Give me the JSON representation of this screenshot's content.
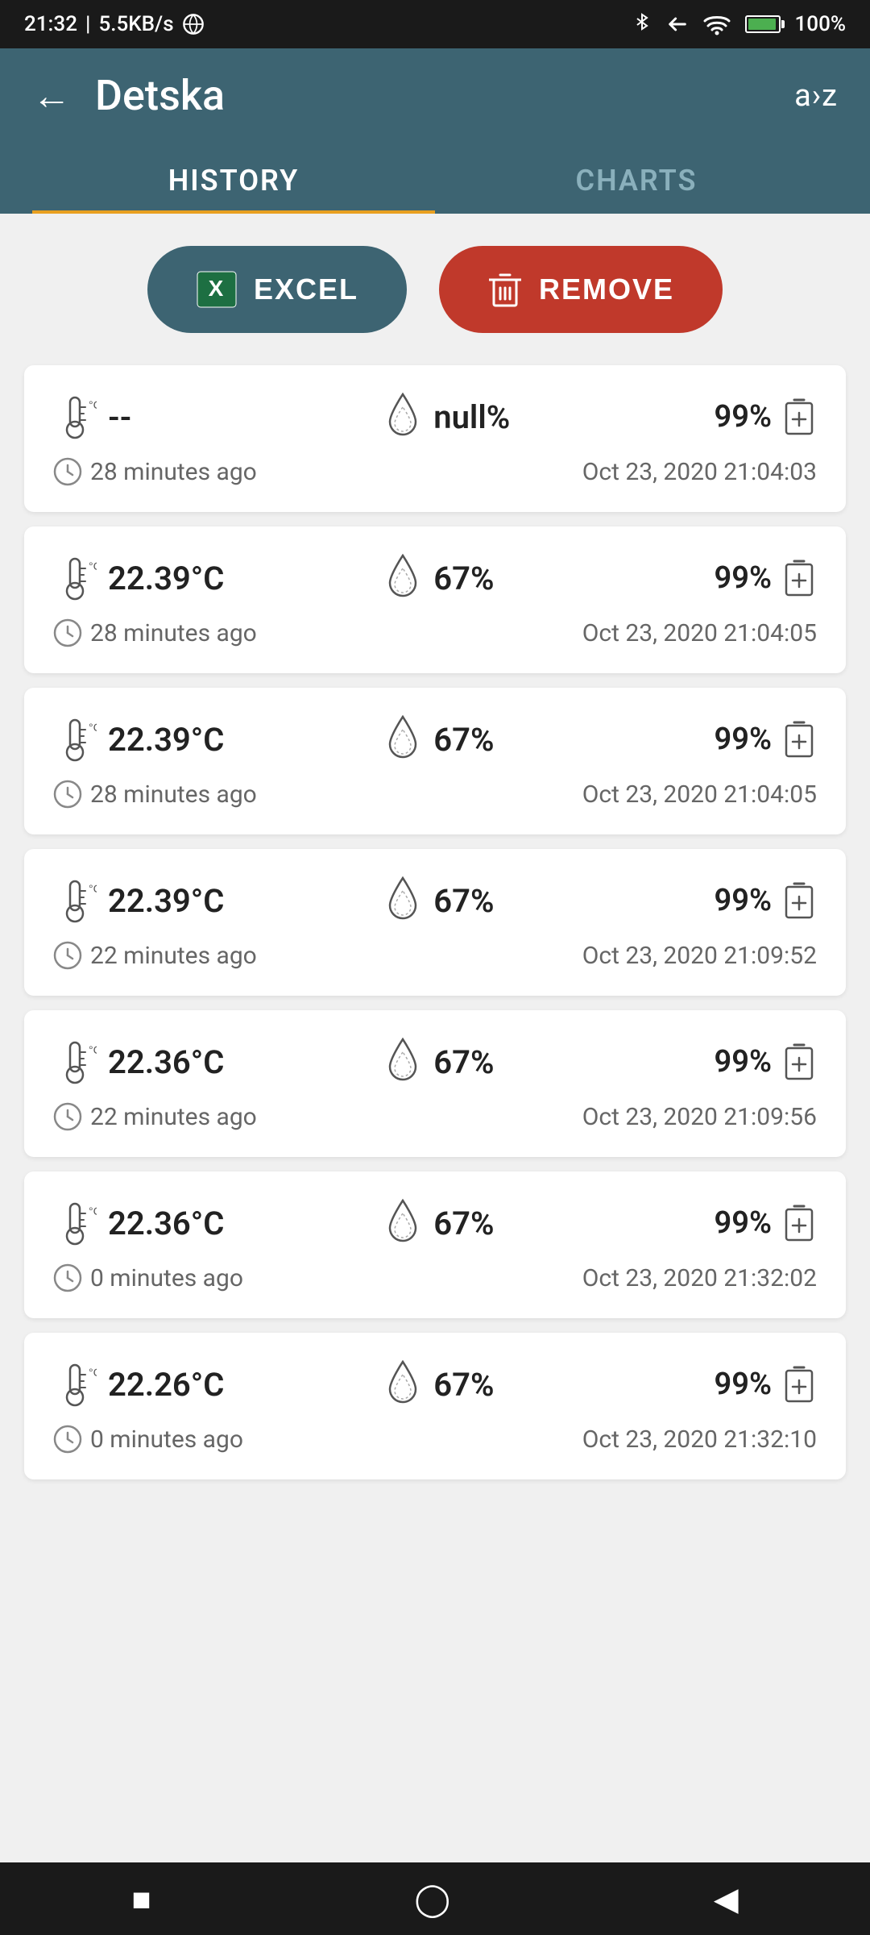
{
  "statusBar": {
    "time": "21:32",
    "network": "5.5KB/s",
    "battery_pct": "100%"
  },
  "header": {
    "title": "Detska",
    "back_label": "←",
    "sort_label": "a›z"
  },
  "tabs": [
    {
      "id": "history",
      "label": "HISTORY",
      "active": true
    },
    {
      "id": "charts",
      "label": "CHARTS",
      "active": false
    }
  ],
  "buttons": {
    "excel_label": "EXCEL",
    "remove_label": "REMOVE"
  },
  "records": [
    {
      "temp": "--",
      "humidity": "null%",
      "battery": "99%",
      "time_ago": "28 minutes ago",
      "date": "Oct 23, 2020 21:04:03"
    },
    {
      "temp": "22.39°C",
      "humidity": "67%",
      "battery": "99%",
      "time_ago": "28 minutes ago",
      "date": "Oct 23, 2020 21:04:05"
    },
    {
      "temp": "22.39°C",
      "humidity": "67%",
      "battery": "99%",
      "time_ago": "28 minutes ago",
      "date": "Oct 23, 2020 21:04:05"
    },
    {
      "temp": "22.39°C",
      "humidity": "67%",
      "battery": "99%",
      "time_ago": "22 minutes ago",
      "date": "Oct 23, 2020 21:09:52"
    },
    {
      "temp": "22.36°C",
      "humidity": "67%",
      "battery": "99%",
      "time_ago": "22 minutes ago",
      "date": "Oct 23, 2020 21:09:56"
    },
    {
      "temp": "22.36°C",
      "humidity": "67%",
      "battery": "99%",
      "time_ago": "0 minutes ago",
      "date": "Oct 23, 2020 21:32:02"
    },
    {
      "temp": "22.26°C",
      "humidity": "67%",
      "battery": "99%",
      "time_ago": "0 minutes ago",
      "date": "Oct 23, 2020 21:32:10"
    }
  ]
}
